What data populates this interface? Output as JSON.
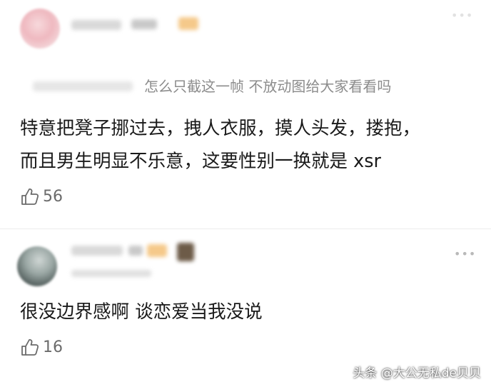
{
  "comments": [
    {
      "reply_text": "怎么只截这一帧  不放动图给大家看看吗",
      "body_lines": [
        "特意把凳子挪过去，拽人衣服，摸人头发，搂抱，",
        "而且男生明显不乐意，这要性别一换就是 xsr"
      ],
      "likes": "56",
      "more_icon": "more-dots-icon",
      "like_icon": "thumbs-up-icon"
    },
    {
      "body_lines": [
        "很没边界感啊 谈恋爱当我没说"
      ],
      "likes": "16",
      "more_icon": "more-dots-icon",
      "like_icon": "thumbs-up-icon"
    }
  ],
  "watermark": "头条 @大公无私de贝贝",
  "more_glyph": "•••",
  "colors": {
    "text": "#1a1a1a",
    "secondary": "#8c8c8c",
    "like_count": "#6b6b6b",
    "divider": "#ececec"
  }
}
